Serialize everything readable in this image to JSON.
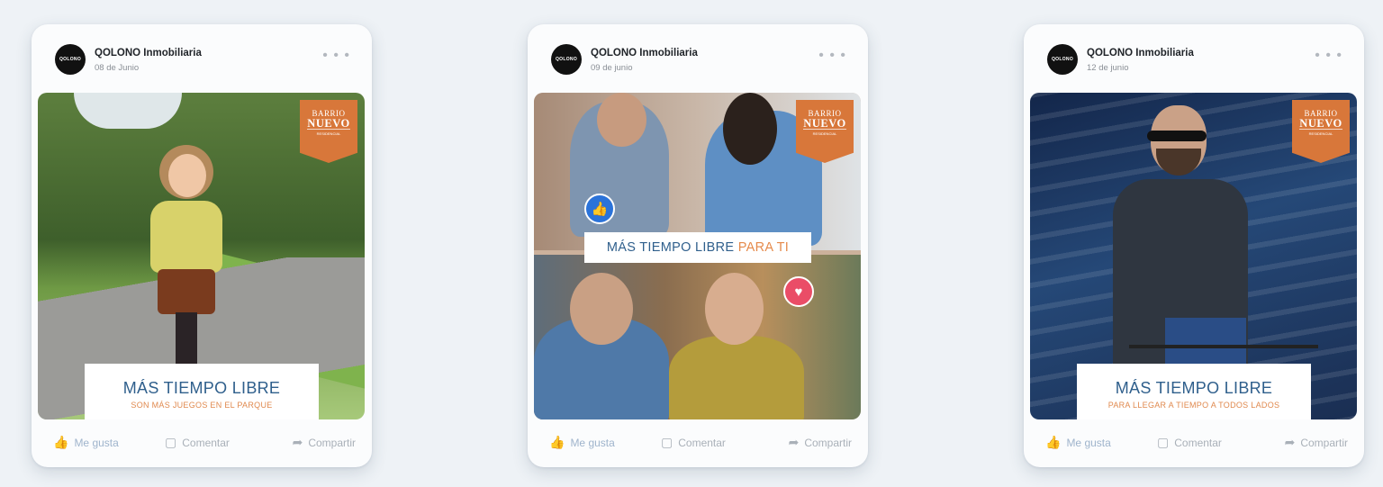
{
  "posts": [
    {
      "page_name": "QOLONO Inmobiliaria",
      "date": "08 de Junio",
      "avatar_text": "QOLONO",
      "badge": {
        "line1": "BARRIO",
        "line2": "NUEVO",
        "line3": "RESIDENCIAL"
      },
      "caption": {
        "line1": "MÁS TIEMPO LIBRE",
        "line2": "SON MÁS JUEGOS EN EL PARQUE"
      },
      "actions": {
        "like": "Me gusta",
        "comment": "Comentar",
        "share": "Compartir"
      }
    },
    {
      "page_name": "QOLONO Inmobiliaria",
      "date": "09 de junio",
      "avatar_text": "QOLONO",
      "badge": {
        "line1": "BARRIO",
        "line2": "NUEVO",
        "line3": "RESIDENCIAL"
      },
      "caption": {
        "part1": "MÁS TIEMPO LIBRE",
        "part2": "PARA TI"
      },
      "actions": {
        "like": "Me gusta",
        "comment": "Comentar",
        "share": "Compartir"
      }
    },
    {
      "page_name": "QOLONO Inmobiliaria",
      "date": "12 de junio",
      "avatar_text": "QOLONO",
      "badge": {
        "line1": "BARRIO",
        "line2": "NUEVO",
        "line3": "RESIDENCIAL"
      },
      "caption": {
        "line1": "MÁS TIEMPO LIBRE",
        "line2": "PARA LLEGAR A TIEMPO A TODOS LADOS"
      },
      "actions": {
        "like": "Me gusta",
        "comment": "Comentar",
        "share": "Compartir"
      }
    }
  ],
  "icons": {
    "more": "more-dots-icon",
    "like": "thumbs-up-icon",
    "comment": "comment-icon",
    "share": "share-arrow-icon",
    "reaction_like": "thumbs-up-reaction-icon",
    "reaction_heart": "heart-reaction-icon"
  },
  "colors": {
    "brand_blue": "#2f5f8c",
    "accent_orange": "#d8773a",
    "like_blue": "#2b73d9",
    "heart_red": "#ea4d67"
  }
}
